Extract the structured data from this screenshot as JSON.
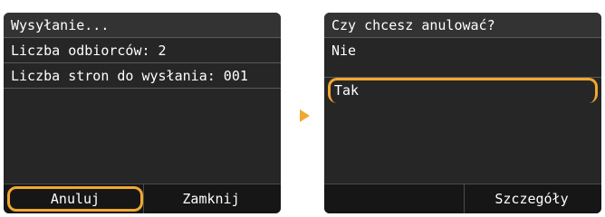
{
  "left_screen": {
    "title": "Wysyłanie...",
    "recipients": "Liczba odbiorców: 2",
    "pages": "Liczba stron do wysłania: 001",
    "cancel_label": "Anuluj",
    "close_label": "Zamknij"
  },
  "right_screen": {
    "title": "Czy chcesz anulować?",
    "option_no": "Nie",
    "option_yes": "Tak",
    "details_label": "Szczegóły"
  },
  "transition_icon": "arrow-right-icon",
  "colors": {
    "screen_bg": "#262626",
    "highlight": "#f0a830",
    "text": "#ffffff"
  }
}
